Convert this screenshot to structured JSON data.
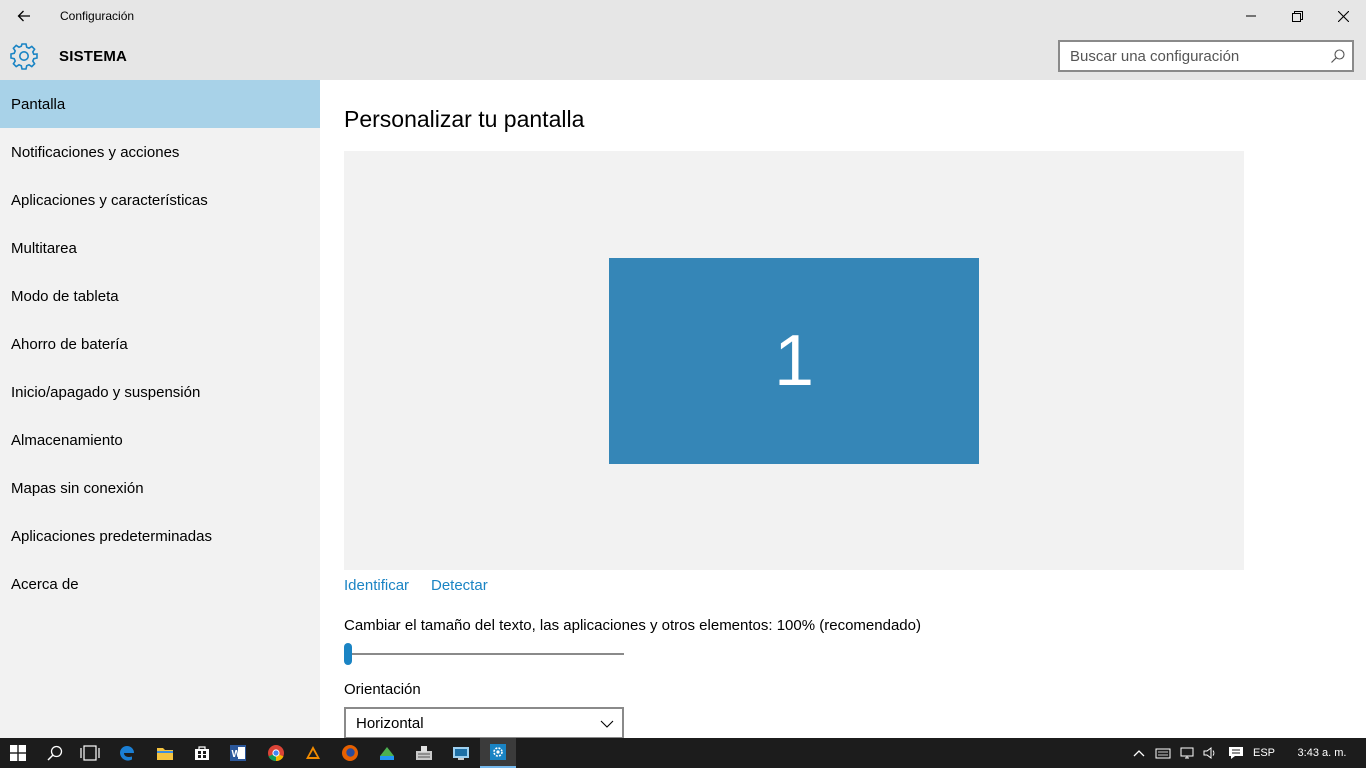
{
  "window": {
    "title": "Configuración"
  },
  "header": {
    "section": "SISTEMA",
    "search_placeholder": "Buscar una configuración"
  },
  "sidebar": {
    "items": [
      {
        "label": "Pantalla",
        "active": true
      },
      {
        "label": "Notificaciones y acciones"
      },
      {
        "label": "Aplicaciones y características"
      },
      {
        "label": "Multitarea"
      },
      {
        "label": "Modo de tableta"
      },
      {
        "label": "Ahorro de batería"
      },
      {
        "label": "Inicio/apagado y suspensión"
      },
      {
        "label": "Almacenamiento"
      },
      {
        "label": "Mapas sin conexión"
      },
      {
        "label": "Aplicaciones predeterminadas"
      },
      {
        "label": "Acerca de"
      }
    ]
  },
  "main": {
    "title": "Personalizar tu pantalla",
    "monitor_number": "1",
    "identify_link": "Identificar",
    "detect_link": "Detectar",
    "scale_label": "Cambiar el tamaño del texto, las aplicaciones y otros elementos: 100% (recomendado)",
    "scale_slider_value": 0,
    "orientation_label": "Orientación",
    "orientation_value": "Horizontal"
  },
  "taskbar": {
    "apps": [
      "start-icon",
      "search-icon",
      "task-view-icon",
      "edge-icon",
      "file-explorer-icon",
      "store-icon",
      "word-icon",
      "chrome-icon",
      "vlc-icon",
      "firefox-icon",
      "app-icon",
      "keyboard-app-icon",
      "remote-app-icon",
      "settings-icon"
    ],
    "language": "ESP",
    "clock": "3:43 a. m."
  },
  "colors": {
    "accent": "#1a84c4",
    "monitor": "#3586b7",
    "active_nav": "#a8d2e8",
    "chrome_bg": "#e6e6e6"
  }
}
